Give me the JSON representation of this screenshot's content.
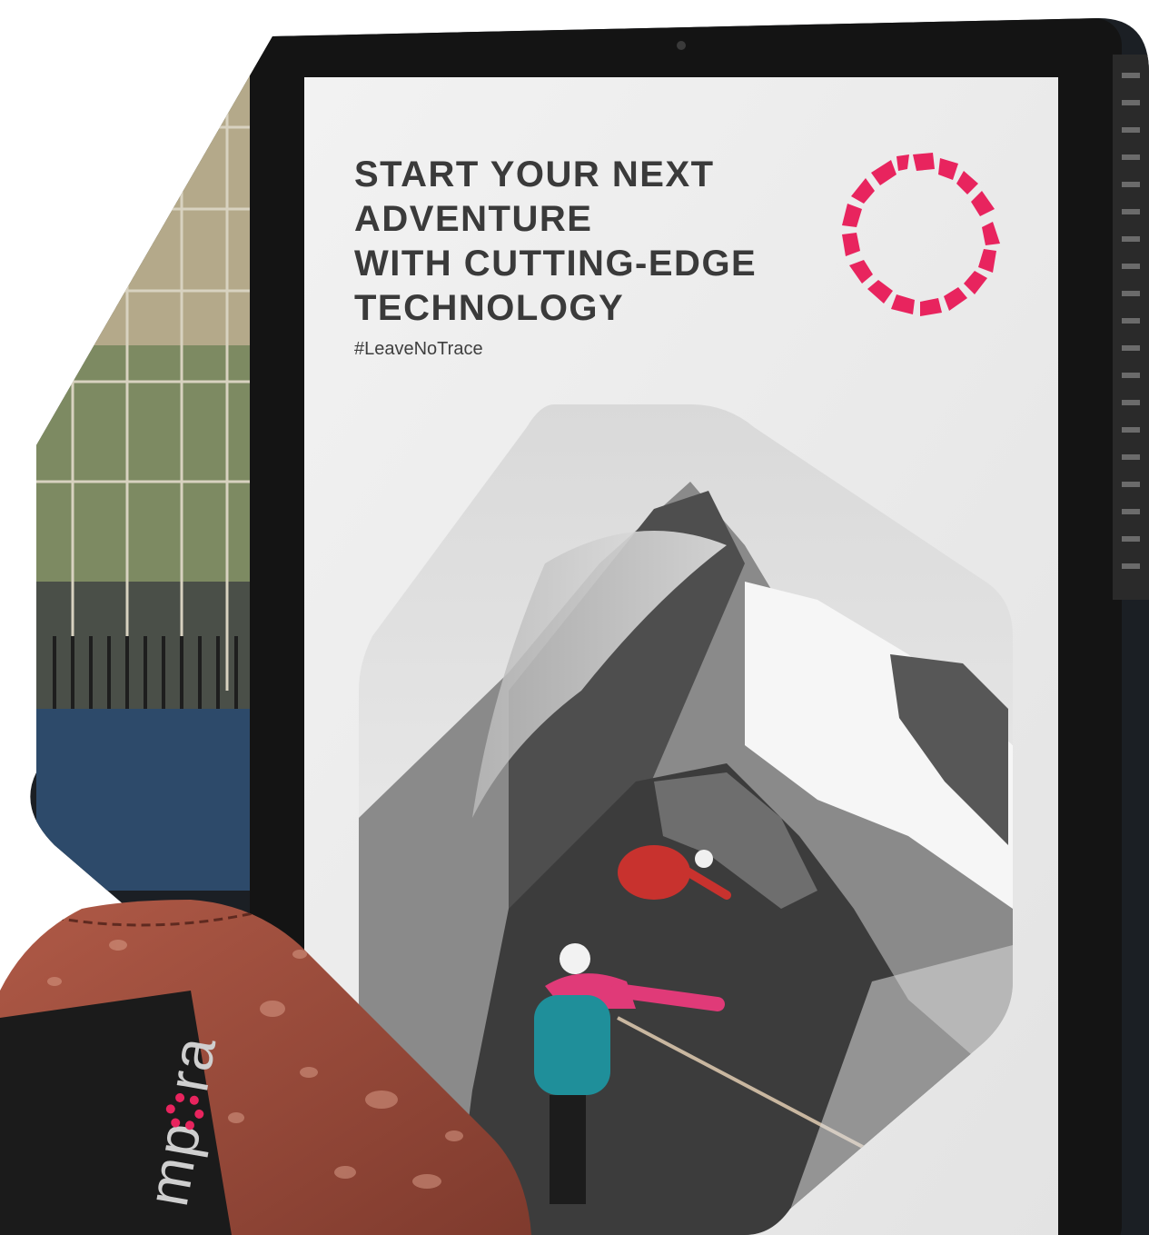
{
  "poster": {
    "headline_lines": [
      "START YOUR NEXT",
      "ADVENTURE",
      "WITH CUTTING-EDGE",
      "TECHNOLOGY"
    ],
    "hashtag": "#LeaveNoTrace"
  },
  "label": {
    "text_before": "mp",
    "text_after": "ra"
  },
  "colors": {
    "brand_pink": "#e8245e",
    "screen_frame": "#141414",
    "leather": "#9a4a3a",
    "climber_jacket": "#e03a78",
    "climber_backpack": "#1f8f9a",
    "lead_climber": "#c8322e"
  },
  "icons": [
    "brand-ring-logo-icon",
    "label-ring-logo-icon"
  ]
}
